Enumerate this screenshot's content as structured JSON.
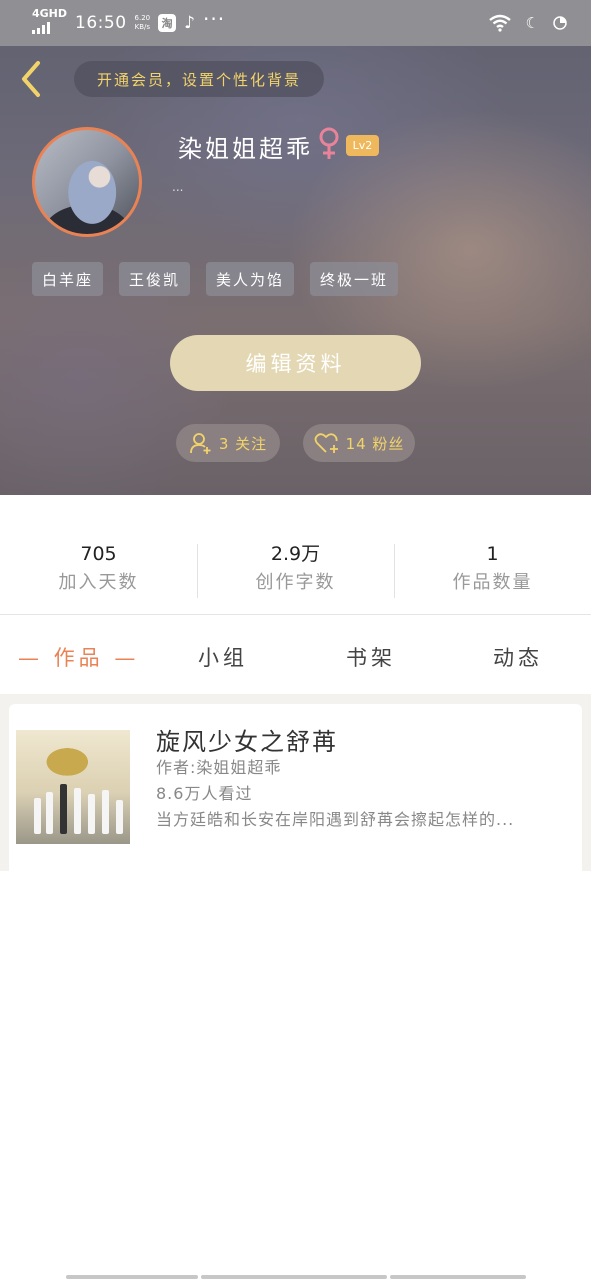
{
  "status_bar": {
    "network": "4GHD",
    "time": "16:50",
    "speed": "6.20",
    "speed_unit": "KB/s",
    "app_icon_label": "淘",
    "icons": [
      "signal-icon",
      "taobao-icon",
      "tiktok-icon",
      "more-icon",
      "wifi-icon",
      "moon-icon",
      "battery-icon"
    ]
  },
  "header": {
    "vip_banner": "开通会员，设置个性化背景"
  },
  "profile": {
    "username": "染姐姐超乖",
    "level": "Lv2",
    "bio": "...",
    "tags": [
      "白羊座",
      "王俊凯",
      "美人为馅",
      "终极一班"
    ],
    "edit_button": "编辑资料",
    "follow_label": "3 关注",
    "fans_label": "14 粉丝"
  },
  "stats": [
    {
      "value": "705",
      "label": "加入天数"
    },
    {
      "value": "2.9万",
      "label": "创作字数"
    },
    {
      "value": "1",
      "label": "作品数量"
    }
  ],
  "tabs": {
    "works": "— 作品 —",
    "group": "小组",
    "shelf": "书架",
    "feed": "动态"
  },
  "works": [
    {
      "title": "旋风少女之舒苒",
      "author": "作者:染姐姐超乖",
      "views": "8.6万人看过",
      "description": "当方廷皓和长安在岸阳遇到舒苒会擦起怎样的..."
    }
  ],
  "colors": {
    "accent": "#e98355",
    "gold": "#f2d36a",
    "edit_button_bg": "#e4d7b3",
    "level_badge": "#f0b85c"
  }
}
